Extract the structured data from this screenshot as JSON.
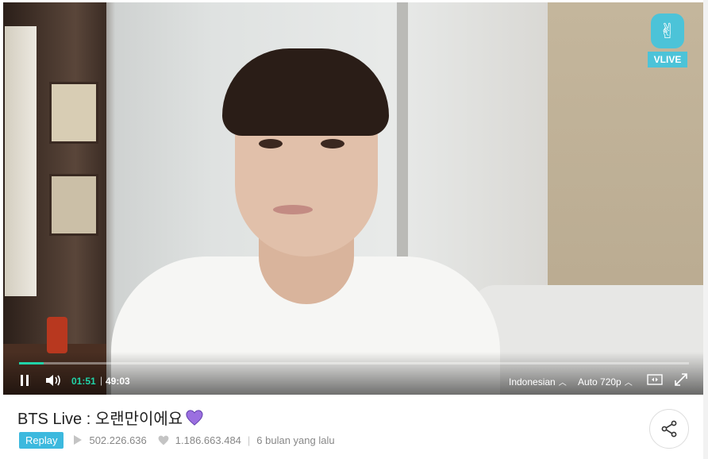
{
  "player": {
    "brand": "VLIVE",
    "progress_fraction": 0.037,
    "time_current": "01:51",
    "time_separator": "|",
    "time_total": "49:03",
    "subtitle_language": "Indonesian",
    "quality": "Auto 720p",
    "accent_color": "#21d3a8",
    "brand_color": "#4cc3d8"
  },
  "video": {
    "title": "BTS Live : 오랜만이에요",
    "badge": "Replay",
    "views": "502.226.636",
    "likes": "1.186.663.484",
    "date": "6 bulan yang lalu",
    "separator": "|"
  }
}
